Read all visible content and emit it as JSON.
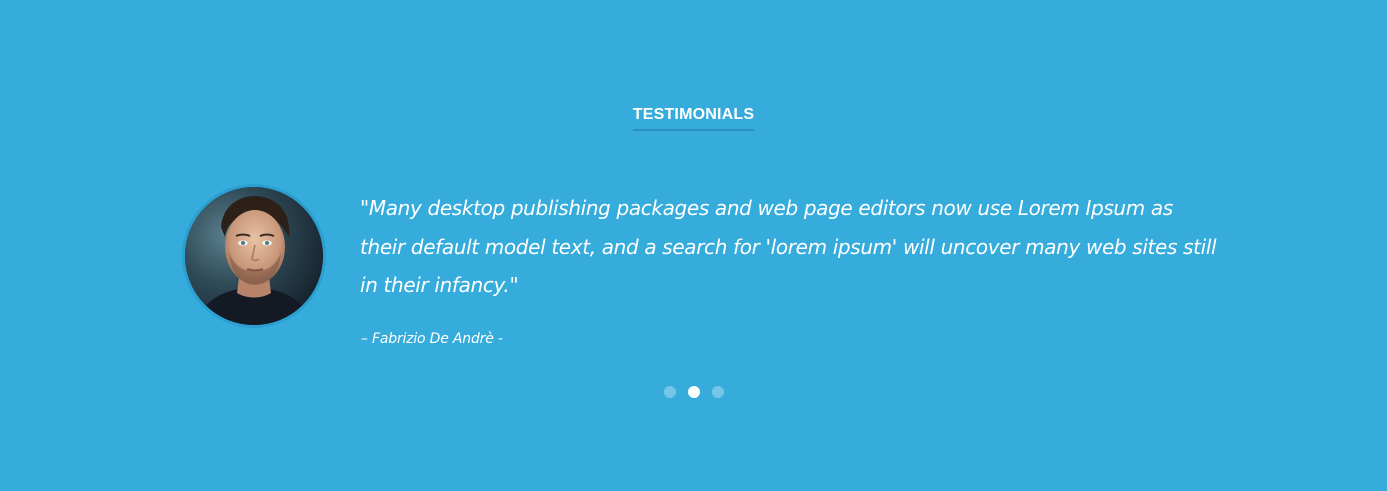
{
  "section": {
    "heading": "TESTIMONIALS"
  },
  "testimonial": {
    "quote": "\"Many desktop publishing packages and web page editors now use Lorem Ipsum as their default model text, and a search for 'lorem ipsum' will uncover many web sites still in their infancy.\"",
    "author": "– Fabrizio De Andrè -"
  },
  "carousel": {
    "slide_count": 3,
    "active_index": 1
  },
  "colors": {
    "background": "#35acdc",
    "text": "#ffffff",
    "heading_underline": "#2c8fc0",
    "avatar_border": "#2a9fd0"
  },
  "icons": {
    "avatar": "person-portrait-photo"
  }
}
